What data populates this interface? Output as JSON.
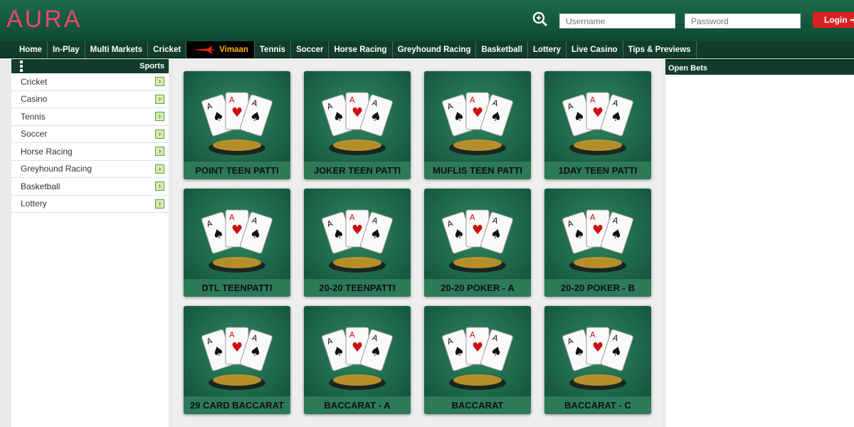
{
  "header": {
    "logo": "AURA",
    "username_placeholder": "Username",
    "password_placeholder": "Password",
    "login_label": "Login"
  },
  "nav": {
    "items": [
      "Home",
      "In-Play",
      "Multi Markets",
      "Cricket",
      "Vimaan",
      "Tennis",
      "Soccer",
      "Horse Racing",
      "Greyhound Racing",
      "Basketball",
      "Lottery",
      "Live Casino",
      "Tips & Previews"
    ]
  },
  "sidebar": {
    "title": "Sports",
    "items": [
      "Cricket",
      "Casino",
      "Tennis",
      "Soccer",
      "Horse Racing",
      "Greyhound Racing",
      "Basketball",
      "Lottery"
    ]
  },
  "games": [
    {
      "label": "POINT TEEN PATTI",
      "icon": "point-cards-icon"
    },
    {
      "label": "JOKER TEEN PATTI",
      "icon": "joker-cards-icon"
    },
    {
      "label": "MUFLIS TEEN PATTI",
      "icon": "muflis-cards-icon"
    },
    {
      "label": "1DAY TEEN PATTI",
      "icon": "oneday-cards-icon"
    },
    {
      "label": "DTL TEENPATTI",
      "icon": "dtl-cards-icon"
    },
    {
      "label": "20-20 TEENPATTI",
      "icon": "2020-teenpatti-icon"
    },
    {
      "label": "20-20 POKER - A",
      "icon": "poker-logo-icon"
    },
    {
      "label": "20-20 POKER - B",
      "icon": "poker-chip-icon"
    },
    {
      "label": "29 CARD BACCARAT",
      "icon": "29-card-icon"
    },
    {
      "label": "BACCARAT - A",
      "icon": "baccarat-a-icon"
    },
    {
      "label": "BACCARAT",
      "icon": "baccarat-crown-icon"
    },
    {
      "label": "BACCARAT - C",
      "icon": "baccarat-c-icon"
    }
  ],
  "open_bets": {
    "title": "Open Bets"
  }
}
